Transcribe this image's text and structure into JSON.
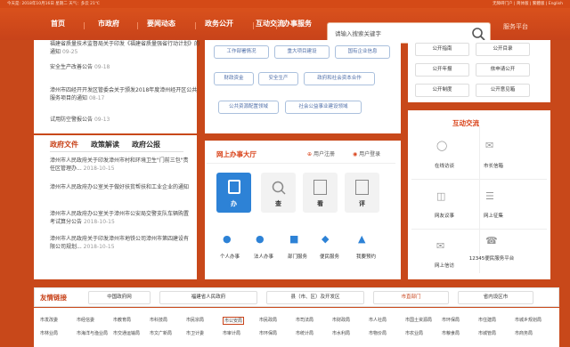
{
  "topbar": {
    "left": "今天是: 2018年10月16日 星期二 天气：多云 21℃",
    "right": "无障碍门户 | 简体版 | 繁體版 | English"
  },
  "nav": {
    "items": [
      "首页",
      "市政府",
      "要闻动态",
      "政务公开",
      "互动交流",
      "办事服务"
    ],
    "search_placeholder": "请输入搜索关键字",
    "portal": "服务平台"
  },
  "news": [
    {
      "text": "福建省质量技术监督局关于印发《福建省质量强省行动计划》的通知",
      "date": "09-25"
    },
    {
      "text": "安全生产改善公告",
      "date": "09-18"
    },
    {
      "text": "漳州市四经开开发区管委会关于颁发2018年度漳州经开区公共服务项目的通知",
      "date": "08-17"
    },
    {
      "text": "试用防空警报公告",
      "date": "09-13"
    }
  ],
  "doc_tabs": [
    "政府文件",
    "政策解读",
    "政府公报"
  ],
  "docs": [
    {
      "text": "漳州市人民政府关于印发漳州市村和环境卫生\"门前三包\"责任区管理办...",
      "date": "2018-10-15"
    },
    {
      "text": "漳州市人民政府办公室关于做好扶贫帮扶和工业企业的通知",
      "date": ""
    },
    {
      "text": "漳州市人民政府办公室关于漳州市公安局交警支队车辆购置考试算分公告",
      "date": "2018-10-15"
    },
    {
      "text": "漳州市人民政府关于印发漳州市地铁公司漳州市第四建设有限公司规划...",
      "date": "2018-10-15"
    }
  ],
  "gov_links": [
    "工作部署情况",
    "重大项目建设",
    "国有企业信息",
    "财政资金",
    "安全生产",
    "政府和社会资本合作",
    "公共资源配置领域",
    "社会公益事业建设领域"
  ],
  "online_service": {
    "title": "网上办事大厅",
    "register": "用户注册",
    "login": "用户登录",
    "buttons": [
      "办",
      "查",
      "看",
      "评"
    ],
    "icons": [
      "个人办事",
      "法人办事",
      "部门服务",
      "便民服务",
      "我要预约"
    ]
  },
  "right_top": [
    "公开指南",
    "公开目录",
    "公开年报",
    "依申请公开",
    "公开制度",
    "公开意见箱"
  ],
  "interaction": {
    "title": "互动交流",
    "items": [
      "在线访谈",
      "市长信箱",
      "网友议事",
      "网上征集",
      "网上信访",
      "12345便民服务平台"
    ]
  },
  "friend": {
    "label": "友情链接",
    "buttons": [
      "中国政府网",
      "福建省人民政府",
      "县（市、区）及开发区",
      "市直部门",
      "省内设区市"
    ]
  },
  "dept_links": [
    "市发改委",
    "市经信委",
    "市教育局",
    "市科技局",
    "市民宗局",
    "市公安局",
    "市民政局",
    "市司法局",
    "市财政局",
    "市人社局",
    "市国土资源局",
    "市环保局",
    "市住建局",
    "市城乡规划局",
    "市林业局",
    "市海洋与渔业局",
    "市交通运输局",
    "市文广新局",
    "市卫计委",
    "市审计局",
    "市环保局",
    "市统计局",
    "市水利局",
    "市物价局",
    "市农业局",
    "市粮食局",
    "市城管局",
    "市商务局"
  ]
}
